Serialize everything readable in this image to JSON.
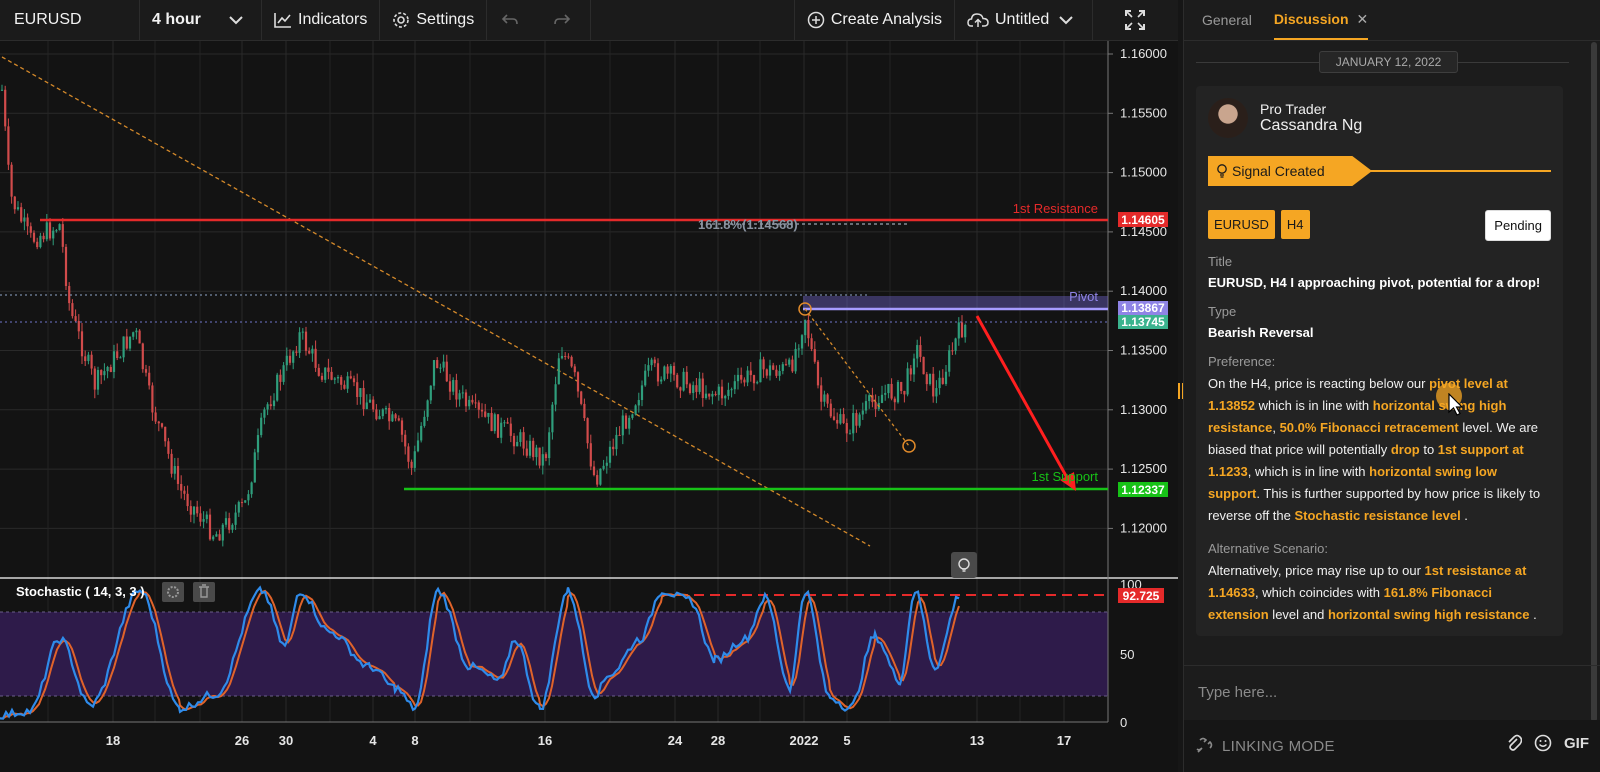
{
  "toolbar": {
    "symbol": "EURUSD",
    "timeframe": "4 hour",
    "indicators": "Indicators",
    "settings": "Settings",
    "create_analysis": "Create Analysis",
    "file_name": "Untitled"
  },
  "chart": {
    "price_ticks": [
      "1.16000",
      "1.15500",
      "1.15000",
      "1.14500",
      "1.14000",
      "1.13500",
      "1.13000",
      "1.12500",
      "1.12000"
    ],
    "date_ticks": [
      "18",
      "26",
      "30",
      "4",
      "8",
      "16",
      "24",
      "28",
      "2022",
      "5",
      "13",
      "17"
    ],
    "levels": {
      "resistance_label": "1st Resistance",
      "resistance_price": "1.14605",
      "fib_label": "161.8%(1.14568)",
      "pivot_label": "Pivot",
      "pivot_price": "1.13867",
      "current_price": "1.13745",
      "support_label": "1st Support",
      "support_price": "1.12337"
    },
    "colors": {
      "resistance": "#e52a2a",
      "support": "#17c217",
      "pivot": "#8f84e6",
      "current": "#3bb38e",
      "fib": "#9aa3b0",
      "accent": "#f5a623"
    }
  },
  "stochastic": {
    "label": "Stochastic ( 14, 3, 3 )",
    "ticks": [
      "100",
      "50",
      "0"
    ],
    "current_value": "92.725"
  },
  "panel": {
    "tabs": [
      "General",
      "Discussion"
    ],
    "active_tab": "Discussion",
    "date": "JANUARY 12, 2022",
    "author_role": "Pro Trader",
    "author_name": "Cassandra Ng",
    "signal": "Signal Created",
    "tags": [
      "EURUSD",
      "H4"
    ],
    "status": "Pending",
    "title_label": "Title",
    "title_value": "EURUSD, H4 I approaching pivot, potential for a drop!",
    "type_label": "Type",
    "type_value": "Bearish Reversal",
    "preference_label": "Preference:",
    "preference": {
      "t1": "On the H4, price is reacting below our ",
      "h1": "pivot level at 1.13852",
      "t2": " which is in line with ",
      "h2": "horizontal swing high resistance",
      "t3": ", ",
      "h3": "50.0% Fibonacci retracement",
      "t4": " level. We are biased that price will potentially ",
      "h4": "drop",
      "t5": " to ",
      "h5": "1st support at 1.1233",
      "t6": ", which is in line with ",
      "h6": "horizontal swing low support",
      "t7": ".  This is further supported by how price is likely to reverse off the ",
      "h7": "Stochastic resistance level",
      "t8": " ."
    },
    "alt_label": "Alternative Scenario:",
    "alternative": {
      "t1": "Alternatively, price may rise up to our ",
      "h1": "1st resistance at 1.14633",
      "t2": ", which coincides with ",
      "h2": "161.8% Fibonacci extension",
      "t3": " level and ",
      "h3": "horizontal swing high resistance",
      "t4": " ."
    },
    "input_placeholder": "Type here...",
    "linking_mode": "LINKING MODE",
    "gif": "GIF"
  }
}
